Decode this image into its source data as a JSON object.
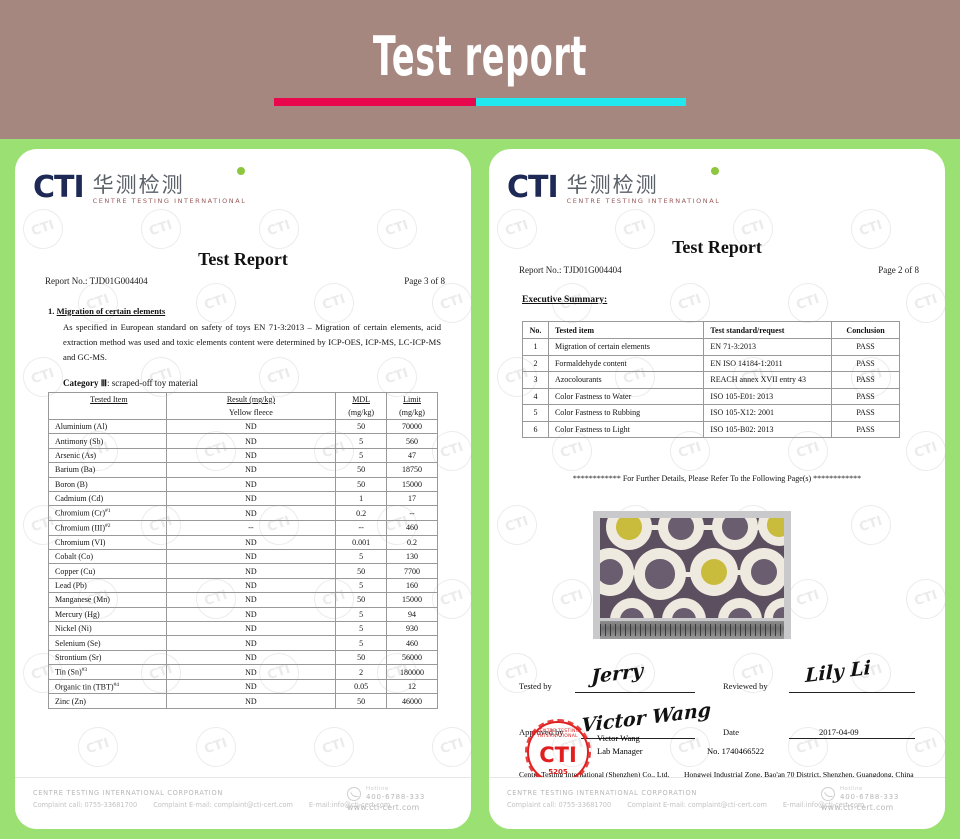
{
  "banner": {
    "title": "Test report",
    "bar_left_color": "#e8064d",
    "bar_right_color": "#1fe8ef",
    "background_color": "#a5877f"
  },
  "page_background_color": "#9be072",
  "logo": {
    "abbr": "CTI",
    "chinese": "华测检测",
    "english": "CENTRE TESTING INTERNATIONAL",
    "dot_color": "#8dc63f",
    "abbr_color": "#1e2a55"
  },
  "watermark_text": "CTI",
  "left_document": {
    "title": "Test Report",
    "report_no": "Report No.: TJD01G004404",
    "page": "Page 3 of 8",
    "section_number": "1.",
    "section_title": "Migration of certain elements",
    "paragraph": "As specified in European standard on safety of toys EN 71-3:2013 – Migration of certain elements, acid extraction method was used and toxic elements content were determined by ICP-OES, ICP-MS, LC-ICP-MS and GC-MS.",
    "category_label": "Category",
    "category_value": "Ⅲ",
    "category_desc": ": scraped-off toy material",
    "table": {
      "headers": {
        "item": "Tested Item",
        "result": "Result (mg/kg)",
        "result_sub": "Yellow fleece",
        "mdl": "MDL",
        "mdl_sub": "(mg/kg)",
        "limit": "Limit",
        "limit_sub": "(mg/kg)"
      },
      "rows": [
        {
          "item": "Aluminium (Al)",
          "sup": "",
          "result": "ND",
          "mdl": "50",
          "limit": "70000"
        },
        {
          "item": "Antimony (Sb)",
          "sup": "",
          "result": "ND",
          "mdl": "5",
          "limit": "560"
        },
        {
          "item": "Arsenic (As)",
          "sup": "",
          "result": "ND",
          "mdl": "5",
          "limit": "47"
        },
        {
          "item": "Barium (Ba)",
          "sup": "",
          "result": "ND",
          "mdl": "50",
          "limit": "18750"
        },
        {
          "item": "Boron (B)",
          "sup": "",
          "result": "ND",
          "mdl": "50",
          "limit": "15000"
        },
        {
          "item": "Cadmium (Cd)",
          "sup": "",
          "result": "ND",
          "mdl": "1",
          "limit": "17"
        },
        {
          "item": "Chromium (Cr)",
          "sup": "#1",
          "result": "ND",
          "mdl": "0.2",
          "limit": "--"
        },
        {
          "item": "Chromium (III)",
          "sup": "#2",
          "result": "--",
          "mdl": "--",
          "limit": "460"
        },
        {
          "item": "Chromium (VI)",
          "sup": "",
          "result": "ND",
          "mdl": "0.001",
          "limit": "0.2"
        },
        {
          "item": "Cobalt   (Co)",
          "sup": "",
          "result": "ND",
          "mdl": "5",
          "limit": "130"
        },
        {
          "item": "Copper (Cu)",
          "sup": "",
          "result": "ND",
          "mdl": "50",
          "limit": "7700"
        },
        {
          "item": "Lead   (Pb)",
          "sup": "",
          "result": "ND",
          "mdl": "5",
          "limit": "160"
        },
        {
          "item": "Manganese (Mn)",
          "sup": "",
          "result": "ND",
          "mdl": "50",
          "limit": "15000"
        },
        {
          "item": "Mercury (Hg)",
          "sup": "",
          "result": "ND",
          "mdl": "5",
          "limit": "94"
        },
        {
          "item": "Nickel (Ni)",
          "sup": "",
          "result": "ND",
          "mdl": "5",
          "limit": "930"
        },
        {
          "item": "Selenium (Se)",
          "sup": "",
          "result": "ND",
          "mdl": "5",
          "limit": "460"
        },
        {
          "item": "Strontium (Sr)",
          "sup": "",
          "result": "ND",
          "mdl": "50",
          "limit": "56000"
        },
        {
          "item": "Tin (Sn)",
          "sup": "#3",
          "result": "ND",
          "mdl": "2",
          "limit": "180000"
        },
        {
          "item": "Organic tin (TBT)",
          "sup": "#4",
          "result": "ND",
          "mdl": "0.05",
          "limit": "12"
        },
        {
          "item": "Zinc (Zn)",
          "sup": "",
          "result": "ND",
          "mdl": "50",
          "limit": "46000"
        }
      ]
    }
  },
  "right_document": {
    "title": "Test Report",
    "report_no": "Report No.: TJD01G004404",
    "page": "Page 2 of 8",
    "exec_summary_heading": "Executive Summary:",
    "summary_table": {
      "headers": [
        "No.",
        "Tested item",
        "Test standard/request",
        "Conclusion"
      ],
      "rows": [
        {
          "no": "1",
          "item": "Migration of certain elements",
          "standard": "EN 71-3:2013",
          "conclusion": "PASS"
        },
        {
          "no": "2",
          "item": "Formaldehyde content",
          "standard": "EN ISO 14184-1:2011",
          "conclusion": "PASS"
        },
        {
          "no": "3",
          "item": "Azocolourants",
          "standard": "REACH annex XVII entry 43",
          "conclusion": "PASS"
        },
        {
          "no": "4",
          "item": "Color Fastness to Water",
          "standard": "ISO 105-E01: 2013",
          "conclusion": "PASS"
        },
        {
          "no": "5",
          "item": "Color Fastness to Rubbing",
          "standard": "ISO 105-X12: 2001",
          "conclusion": "PASS"
        },
        {
          "no": "6",
          "item": "Color Fastness to Light",
          "standard": "ISO 105-B02: 2013",
          "conclusion": "PASS"
        }
      ]
    },
    "further_details": "************ For Further Details, Please Refer To the Following Page(s) ************",
    "signatures": {
      "tested_by_label": "Tested    by",
      "tested_by_name": "Jerry",
      "reviewed_by_label": "Reviewed by",
      "reviewed_by_name": "Lily Li",
      "approved_by_label": "Approved by",
      "approved_by_name": "Victor Wang",
      "date_label": "Date",
      "date_value": "2017-04-09",
      "approver_name": "Victor Wang",
      "approver_role": "Lab Manager",
      "cert_no": "No. 1740466522"
    },
    "stamp": {
      "ring_text": "CENTRE TESTING INTERNATIONAL",
      "center": "CTI",
      "number": "5205",
      "color": "#e02020"
    },
    "company_line": "Centre Testing International (Shenzhen) Co., Ltd.",
    "address_line": "Hongwei Industrial Zone, Bao'an 70 District, Shenzhen, Guangdong, China"
  },
  "footer": {
    "organization": "CENTRE TESTING INTERNATIONAL CORPORATION",
    "complaint_call": "Complaint call: 0755-33681700",
    "complaint_email": "Complaint E-mail: complaint@cti-cert.com",
    "email": "E-mail:info@cti-cert.com",
    "hotline_label": "Hotline",
    "hotline_number": "400-6788-333",
    "website": "www.cti-cert.com"
  }
}
